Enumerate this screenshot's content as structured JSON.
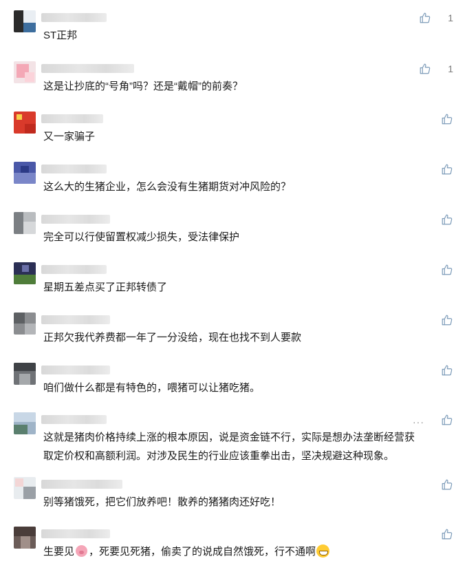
{
  "comments": [
    {
      "text": "ST正邦",
      "likes": "1"
    },
    {
      "text": "这是让抄底的“号角”吗？还是“戴帽”的前奏？",
      "likes": "1"
    },
    {
      "text": "又一家骗子",
      "likes": ""
    },
    {
      "text": "这么大的生猪企业，怎么会没有生猪期货对冲风险的？",
      "likes": ""
    },
    {
      "text": "完全可以行使留置权减少损失，受法律保护",
      "likes": ""
    },
    {
      "text": "星期五差点买了正邦转债了",
      "likes": ""
    },
    {
      "text": "正邦欠我代养费都一年了一分没给，现在也找不到人要款",
      "likes": ""
    },
    {
      "text": "咱们做什么都是有特色的，喂猪可以让猪吃猪。",
      "likes": ""
    },
    {
      "text_line1": "这就是猪肉价格持续上涨的根本原因，说是资金链不行，实际是想办法垄断经营获",
      "text_line2": "取定价权和高额利润。对涉及民生的行业应该重拳出击，坚决规避这种现象。",
      "more": "···",
      "likes": ""
    },
    {
      "text": "别等猪饿死，把它们放养吧！散养的猪猪肉还好吃！",
      "likes": ""
    },
    {
      "text_part1": "生要见",
      "text_part2": "，死要见死猪，偷卖了的说成自然饿死，行不通啊",
      "likes": ""
    }
  ],
  "icons": {
    "like": "thumbs-up-icon",
    "pig": "pig-face-emoji",
    "grin": "grinning-face-emoji"
  },
  "colors": {
    "text": "#1a1a1a",
    "meta": "#7a7a7a",
    "icon": "#7b9ab8"
  }
}
